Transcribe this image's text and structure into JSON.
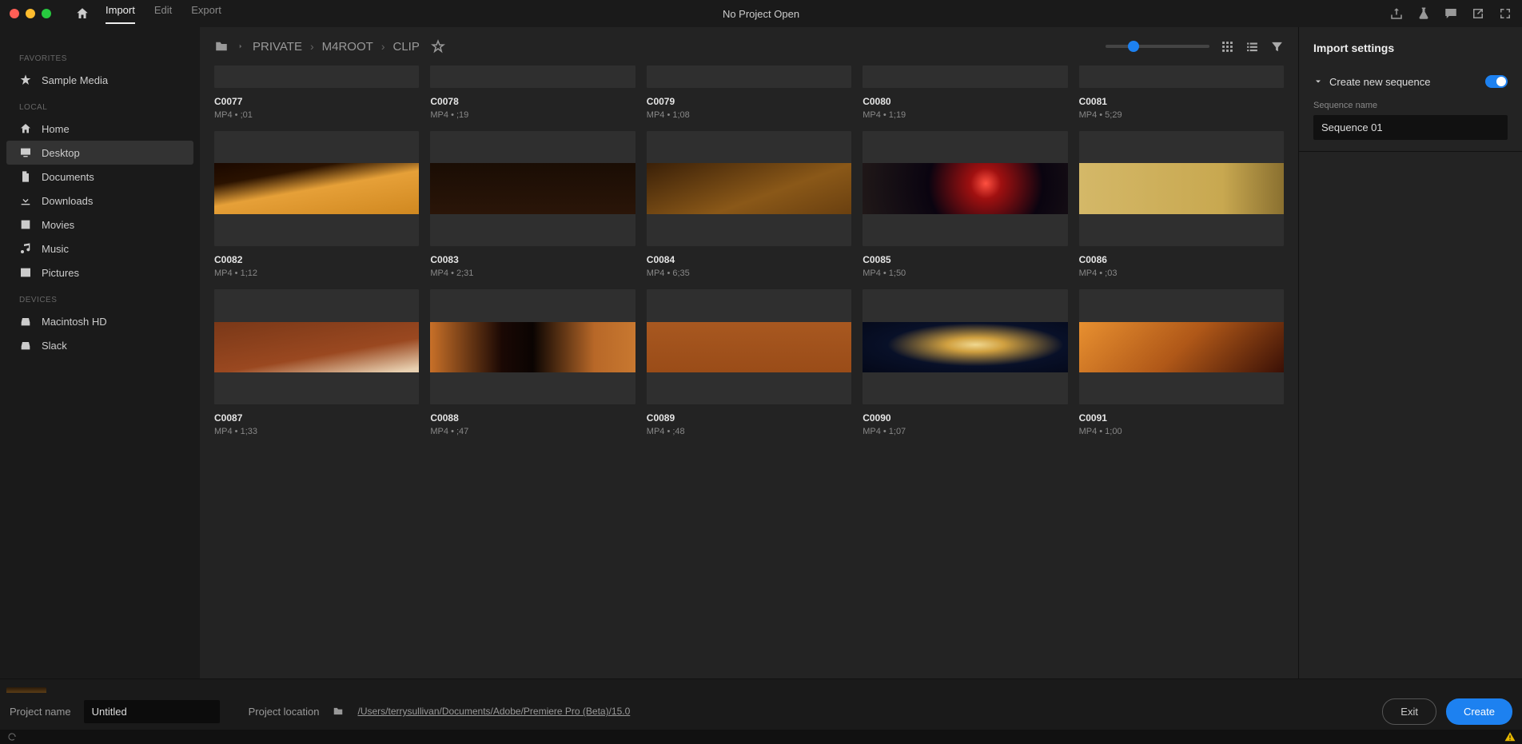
{
  "topbar": {
    "tabs": [
      "Import",
      "Edit",
      "Export"
    ],
    "active_tab": 0,
    "center_title": "No Project Open"
  },
  "sidebar": {
    "favorites_header": "FAVORITES",
    "favorites": [
      {
        "label": "Sample Media",
        "icon": "star"
      }
    ],
    "local_header": "LOCAL",
    "local": [
      {
        "label": "Home",
        "icon": "home"
      },
      {
        "label": "Desktop",
        "icon": "desktop",
        "active": true
      },
      {
        "label": "Documents",
        "icon": "document"
      },
      {
        "label": "Downloads",
        "icon": "download"
      },
      {
        "label": "Movies",
        "icon": "movies"
      },
      {
        "label": "Music",
        "icon": "music"
      },
      {
        "label": "Pictures",
        "icon": "pictures"
      }
    ],
    "devices_header": "DEVICES",
    "devices": [
      {
        "label": "Macintosh HD",
        "icon": "drive"
      },
      {
        "label": "Slack",
        "icon": "drive"
      }
    ]
  },
  "breadcrumb": [
    "PRIVATE",
    "M4ROOT",
    "CLIP"
  ],
  "clips_row0": [
    {
      "name": "C0077",
      "meta": "MP4 • ;01"
    },
    {
      "name": "C0078",
      "meta": "MP4 • ;19"
    },
    {
      "name": "C0079",
      "meta": "MP4 • 1;08"
    },
    {
      "name": "C0080",
      "meta": "MP4 • 1;19"
    },
    {
      "name": "C0081",
      "meta": "MP4 • 5;29"
    }
  ],
  "clips_row1": [
    {
      "name": "C0082",
      "meta": "MP4 • 1;12",
      "bg": "linear-gradient(170deg,#1a0800 0%,#2a1200 25%,#e6a038 50%,#d08820 100%)"
    },
    {
      "name": "C0083",
      "meta": "MP4 • 2;31",
      "bg": "linear-gradient(#1a0d04,#2a1508)"
    },
    {
      "name": "C0084",
      "meta": "MP4 • 6;35",
      "bg": "linear-gradient(160deg,#3a2008,#8a5818 60%,#6a4010)"
    },
    {
      "name": "C0085",
      "meta": "MP4 • 1;50",
      "bg": "radial-gradient(circle at 60% 40%,#ff5040 0%,#a01010 12%,#0a0410 45%,#201818 100%)"
    },
    {
      "name": "C0086",
      "meta": "MP4 • ;03",
      "bg": "linear-gradient(90deg,#d4b868,#c8a850 70%,#8a7030)"
    }
  ],
  "clips_row2": [
    {
      "name": "C0087",
      "meta": "MP4 • 1;33",
      "bg": "linear-gradient(170deg,#7a3818,#9a4820 60%,#e8d0b0 95%)"
    },
    {
      "name": "C0088",
      "meta": "MP4 • ;47",
      "bg": "linear-gradient(90deg,#c87028 0%,#1a0804 35%,#0a0402 50%,#b86828 80%,#c87830)"
    },
    {
      "name": "C0089",
      "meta": "MP4 • ;48",
      "bg": "linear-gradient(#a85820,#9a4c18)"
    },
    {
      "name": "C0090",
      "meta": "MP4 • 1;07",
      "bg": "radial-gradient(ellipse at 55% 45%,#f0d890 0%,#d0a040 18%,#081028 55%,#040818)"
    },
    {
      "name": "C0091",
      "meta": "MP4 • 1;00",
      "bg": "linear-gradient(135deg,#e89030 0%,#b05818 50%,#3a1006 100%)"
    }
  ],
  "settings": {
    "title": "Import settings",
    "create_sequence_label": "Create new sequence",
    "sequence_name_label": "Sequence name",
    "sequence_name_value": "Sequence 01"
  },
  "footer": {
    "project_name_label": "Project name",
    "project_name_value": "Untitled",
    "project_location_label": "Project location",
    "project_location_path": "/Users/terrysullivan/Documents/Adobe/Premiere Pro (Beta)/15.0",
    "exit_label": "Exit",
    "create_label": "Create"
  }
}
